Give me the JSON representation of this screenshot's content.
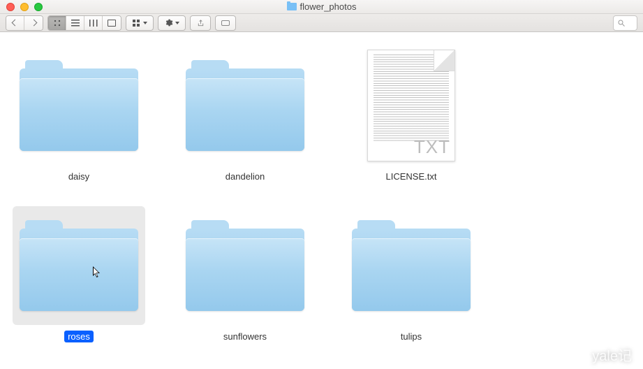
{
  "window": {
    "title": "flower_photos"
  },
  "items": [
    {
      "name": "daisy",
      "kind": "folder",
      "selected": false
    },
    {
      "name": "dandelion",
      "kind": "folder",
      "selected": false
    },
    {
      "name": "LICENSE.txt",
      "kind": "txt",
      "selected": false,
      "ext_label": "TXT"
    },
    {
      "name": "roses",
      "kind": "folder",
      "selected": true
    },
    {
      "name": "sunflowers",
      "kind": "folder",
      "selected": false
    },
    {
      "name": "tulips",
      "kind": "folder",
      "selected": false
    }
  ],
  "watermark": "yale记"
}
